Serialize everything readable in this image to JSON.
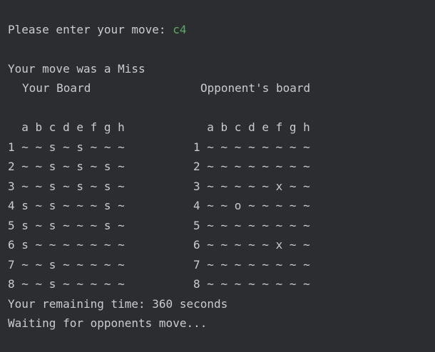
{
  "prompt": {
    "label": "Please enter your move: ",
    "input": "c4"
  },
  "result": "Your move was a Miss",
  "your_board": {
    "title": "Your Board",
    "header": "  a b c d e f g h",
    "rows": [
      "1 ~ ~ s ~ s ~ ~ ~",
      "2 ~ ~ s ~ s ~ s ~",
      "3 ~ ~ s ~ s ~ s ~",
      "4 s ~ s ~ ~ ~ s ~",
      "5 s ~ s ~ ~ ~ s ~",
      "6 s ~ ~ ~ ~ ~ ~ ~",
      "7 ~ ~ s ~ ~ ~ ~ ~",
      "8 ~ ~ s ~ ~ ~ ~ ~"
    ]
  },
  "opponent_board": {
    "title": "Opponent's board",
    "header": "  a b c d e f g h",
    "rows": [
      "1 ~ ~ ~ ~ ~ ~ ~ ~",
      "2 ~ ~ ~ ~ ~ ~ ~ ~",
      "3 ~ ~ ~ ~ ~ x ~ ~",
      "4 ~ ~ o ~ ~ ~ ~ ~",
      "5 ~ ~ ~ ~ ~ ~ ~ ~",
      "6 ~ ~ ~ ~ ~ x ~ ~",
      "7 ~ ~ ~ ~ ~ ~ ~ ~",
      "8 ~ ~ ~ ~ ~ ~ ~ ~"
    ]
  },
  "timer": "Your remaining time: 360 seconds",
  "status": "Waiting for opponents move..."
}
